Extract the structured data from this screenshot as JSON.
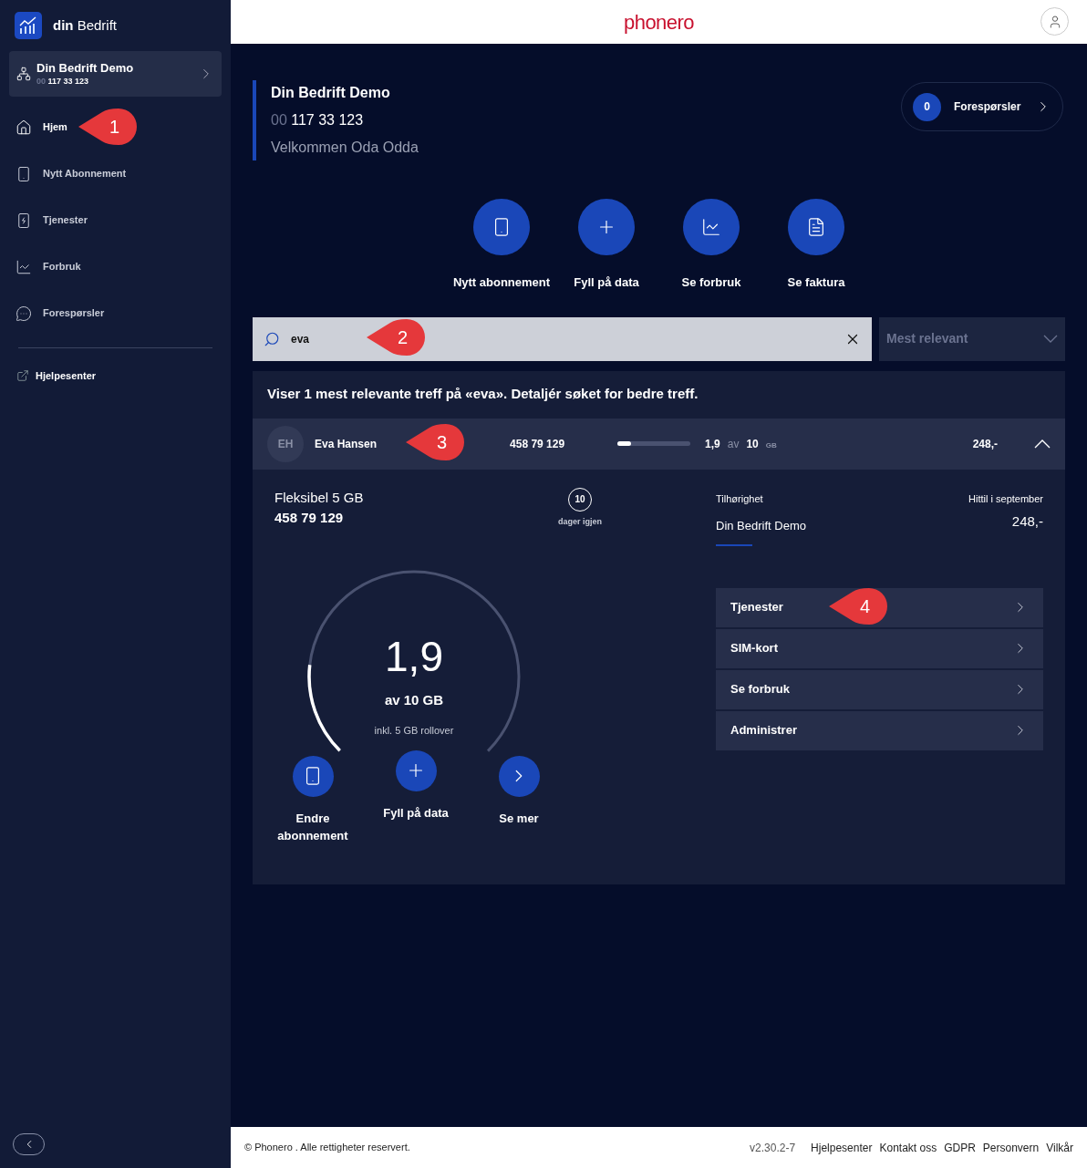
{
  "brand": {
    "bold": "din",
    "rest": "Bedrift"
  },
  "company_switcher": {
    "name": "Din Bedrift Demo",
    "prefix": "00",
    "number": "117 33 123"
  },
  "nav": [
    {
      "label": "Hjem",
      "kind": "home",
      "selected": true,
      "callout": "1"
    },
    {
      "label": "Nytt Abonnement",
      "kind": "phone",
      "selected": false
    },
    {
      "label": "Tjenester",
      "kind": "services",
      "selected": false
    },
    {
      "label": "Forbruk",
      "kind": "usage",
      "selected": false
    },
    {
      "label": "Forespørsler",
      "kind": "requests",
      "selected": false
    }
  ],
  "help_link": "Hjelpesenter",
  "header": {
    "logo": "phonero"
  },
  "company": {
    "name": "Din Bedrift Demo",
    "prefix": "00",
    "number": "117 33 123",
    "welcome": "Velkommen Oda Odda"
  },
  "requests": {
    "count": "0",
    "label": "Forespørsler"
  },
  "quick_actions": [
    {
      "label": "Nytt abonnement",
      "kind": "phone"
    },
    {
      "label": "Fyll på data",
      "kind": "plus"
    },
    {
      "label": "Se forbruk",
      "kind": "usage"
    },
    {
      "label": "Se faktura",
      "kind": "invoice"
    }
  ],
  "search": {
    "value": "eva",
    "callout": "2"
  },
  "sort": {
    "value": "Mest relevant"
  },
  "result_summary": "Viser 1 mest relevante treff på «eva». Detaljér søket for bedre treff.",
  "subscriber": {
    "initials": "EH",
    "name": "Eva Hansen",
    "callout": "3",
    "number": "458 79 129",
    "level": 0.19,
    "used": "1,9",
    "of": "av",
    "total": "10",
    "unit": "GB",
    "price": "248,-",
    "expanded": true,
    "plan": "Fleksibel 5 GB",
    "plan_number": "458 79 129",
    "days": "10",
    "days_label": "dager igjen",
    "affiliation_label": "Tilhørighet",
    "affiliation": "Din Bedrift Demo",
    "period_label": "Hittil i september",
    "period_amount": "248,-",
    "gauge": {
      "level": 0.19,
      "value": "1,9",
      "label": "av 10 GB",
      "note": "inkl. 5 GB rollover"
    },
    "actions": [
      {
        "label": "Endre abonnement",
        "kind": "phone"
      },
      {
        "label": "Fyll på data",
        "kind": "plus"
      },
      {
        "label": "Se mer",
        "kind": "chevron"
      }
    ],
    "menu": [
      {
        "label": "Tjenester",
        "callout": "4"
      },
      {
        "label": "SIM-kort"
      },
      {
        "label": "Se forbruk"
      },
      {
        "label": "Administrer"
      }
    ]
  },
  "footer": {
    "copyright": "© Phonero . Alle rettigheter reservert.",
    "version": "v2.30.2-7",
    "links": [
      "Hjelpesenter",
      "Kontakt oss",
      "GDPR",
      "Personvern",
      "Vilkår"
    ]
  }
}
